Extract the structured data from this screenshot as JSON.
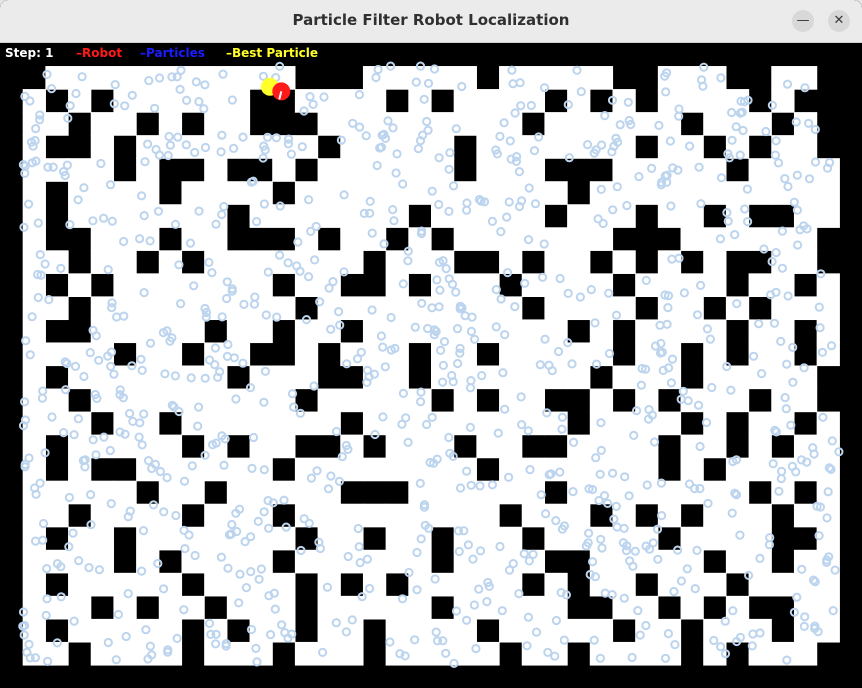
{
  "window": {
    "title": "Particle Filter Robot Localization",
    "minimize_glyph": "—",
    "close_glyph": "✕"
  },
  "legend": {
    "step": "Step: 1",
    "robot": "–Robot",
    "particles": "–Particles",
    "best_particle": "–Best Particle"
  },
  "colors": {
    "wall": "#000000",
    "free": "#ffffff",
    "robot": "#ff1a1a",
    "particles": "#1c1cff",
    "particle_marks": "#bcd4ee",
    "best_particle": "#ffff2a"
  },
  "maze": {
    "rows": 28,
    "cols": 38,
    "grid": [
      "######################################",
      "##...........###.....#.....##...##..##",
      "#.#.#......##....#.#....#.#.#....#.###",
      "#..#..#.#..###.........#......#...#.##",
      "#.##.#........#.....#.......#..#.#..##",
      "#....#.##.##.#......#...###.....#....#",
      "#.#....#....#............#...........#",
      "#.#.......#.......#.....#...#..#.##..##",
      "#.##...#..###.#..#.#.......###......##",
      "#..#..#.#.......#...##.#..#.#.#.##..##",
      "#.#.#.......#..##.#...#....#....#..#.#",
      "#..#.........#.........#....#..#.#...#",
      "#.##.....#..#..#.........#.#....#..#.#",
      "#....#..#..##.#...#..#.....#..#.#..#.#",
      "#.#.......#...##..#.......#...#.....##",
      "#..#.........#.....#.#..##.#.#...#..##",
      "#...#..#.......#.........#....#.#..#.#",
      "#.#.....#.#..##.#...#..##....#..#.#..#",
      "#.#.##......#........#.......#.#.....#",
      "#.....#..#.....###......#........#.#.#",
      "#..#....#...#.........#...#.#.#...#..#",
      "#.#..#.......#..#..#...#.....#....##.#",
      "#....#.#....#......#....##.....#..#..#",
      "#.#.....#....#.#.#.....#.#..#...#....#",
      "#...#.#..#...#.....#.....##..#.#.##..#",
      "#.#.....#.#..#..#....#.....#..#...#..#",
      "#..#....#...#...#.....#..#....#.#...##",
      "######################################"
    ]
  },
  "robot": {
    "row": 2.1,
    "col": 12.4
  },
  "best_particle": {
    "row": 1.9,
    "col": 11.9
  },
  "particles": {
    "count": 900,
    "seed": 7
  }
}
